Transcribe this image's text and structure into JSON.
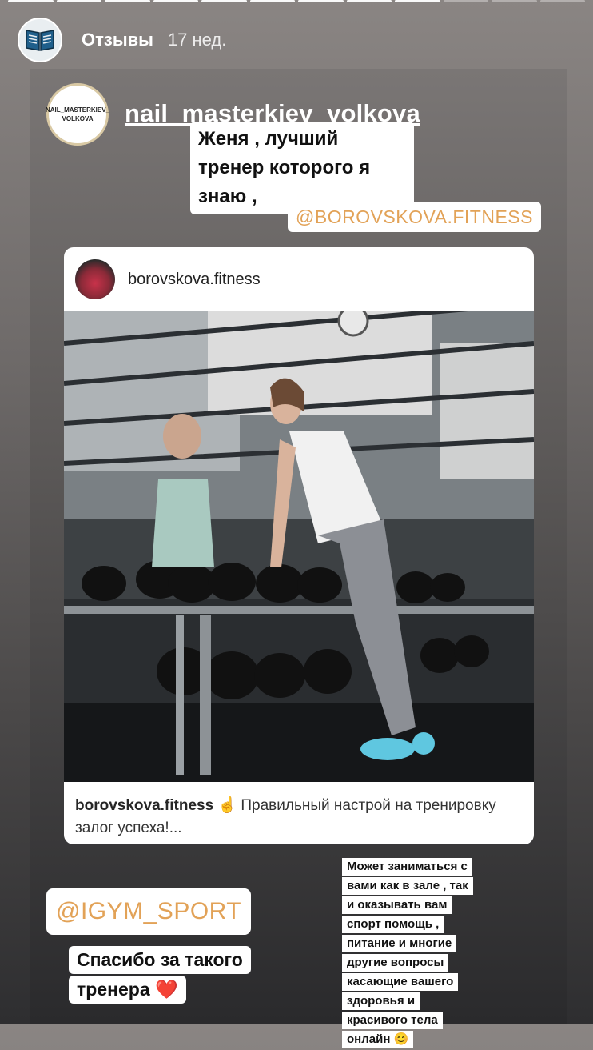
{
  "story": {
    "progress": {
      "total": 12,
      "viewed": 9
    },
    "author_name": "Отзывы",
    "time_ago": "17 нед.",
    "author_avatar_icon": "book-icon"
  },
  "repost": {
    "username": "nail_masterkiev_volkova",
    "avatar_line1": "NAIL_MASTERKIEV_",
    "avatar_line2": "VOLKOVA",
    "message": "Женя , лучший тренер которого я знаю ,",
    "mention": "@BOROVSKOVA.FITNESS"
  },
  "post": {
    "username": "borovskova.fitness",
    "caption_user": "borovskova.fitness",
    "caption_text": "☝️ Правильный настрой на тренировку залог успеха!...",
    "image_subject": "gym-dumbbell-photo"
  },
  "stickers": {
    "gym_mention": "@IGYM_SPORT",
    "thanks_line1": "Спасибо за такого",
    "thanks_line2": "тренера ❤️",
    "info_lines": [
      "Может заниматься с",
      "вами как в зале , так",
      "и оказывать вам",
      "спорт помощь ,",
      "питание и многие",
      "другие вопросы",
      "касающие вашего",
      "здоровья и",
      "красивого тела",
      "онлайн 😊"
    ]
  },
  "colors": {
    "mention_text": "#e2a257",
    "background_top": "#8a8583",
    "background_bottom": "#2e2e30"
  }
}
